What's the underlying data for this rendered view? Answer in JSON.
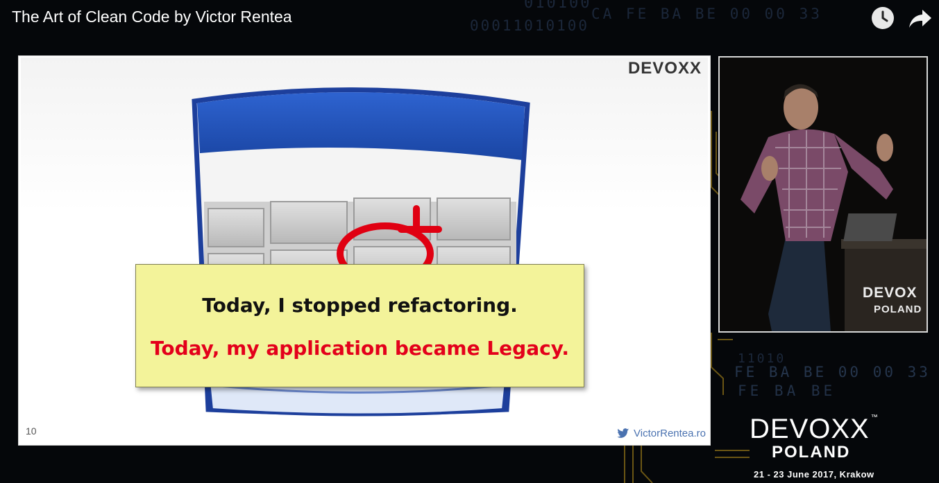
{
  "video": {
    "title": "The Art of Clean Code by Victor Rentea",
    "controls": {
      "watch_later_icon": "clock-icon",
      "share_icon": "share-arrow-icon"
    }
  },
  "background": {
    "code_lines": [
      "010100",
      "CA FE BA BE 00 00 33",
      "00011010100",
      "11010",
      "FE BA BE 00 00 33",
      "FE BA BE"
    ]
  },
  "slide": {
    "brand": "DEVOXX",
    "number": "10",
    "footer": "VictorRentea.ro",
    "callout": {
      "line1": "Today, I stopped refactoring.",
      "line2": "Today, my application became Legacy."
    },
    "colors": {
      "callout_bg": "#f3f39a",
      "line2": "#e3001b",
      "calendar_header": "#1f4fb0"
    }
  },
  "speaker_feed": {
    "stage_logo": "DEVOX",
    "stage_logo_sub": "POLAND"
  },
  "brand": {
    "name": "DEVOXX",
    "country": "POLAND",
    "dates": "21 - 23 June 2017, Krakow",
    "accent": "#f29a1e"
  }
}
